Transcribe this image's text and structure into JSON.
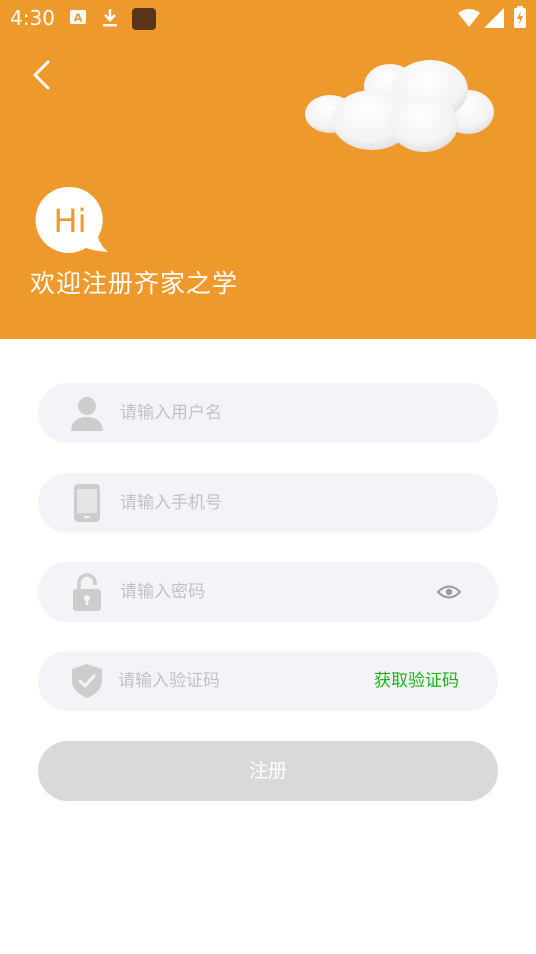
{
  "status_bar": {
    "time": "4:30",
    "icons": [
      "text-a-icon",
      "download-icon",
      "app-square-icon",
      "wifi-icon",
      "signal-icon",
      "battery-charging-icon"
    ]
  },
  "header": {
    "back_icon": "chevron-left-icon",
    "decoration": "cloud-illustration",
    "hi_badge": "Hi",
    "welcome_text": "欢迎注册齐家之学",
    "background_color": "#ee992c"
  },
  "form": {
    "username": {
      "placeholder": "请输入用户名",
      "value": "",
      "icon": "user-icon"
    },
    "phone": {
      "placeholder": "请输入手机号",
      "value": "",
      "icon": "phone-icon"
    },
    "password": {
      "placeholder": "请输入密码",
      "value": "",
      "icon": "lock-open-icon",
      "toggle_icon": "eye-icon"
    },
    "code": {
      "placeholder": "请输入验证码",
      "value": "",
      "icon": "shield-check-icon",
      "get_code_label": "获取验证码",
      "get_code_color": "#1bb41b"
    },
    "submit_label": "注册",
    "submit_color": "#d9d9d9"
  }
}
